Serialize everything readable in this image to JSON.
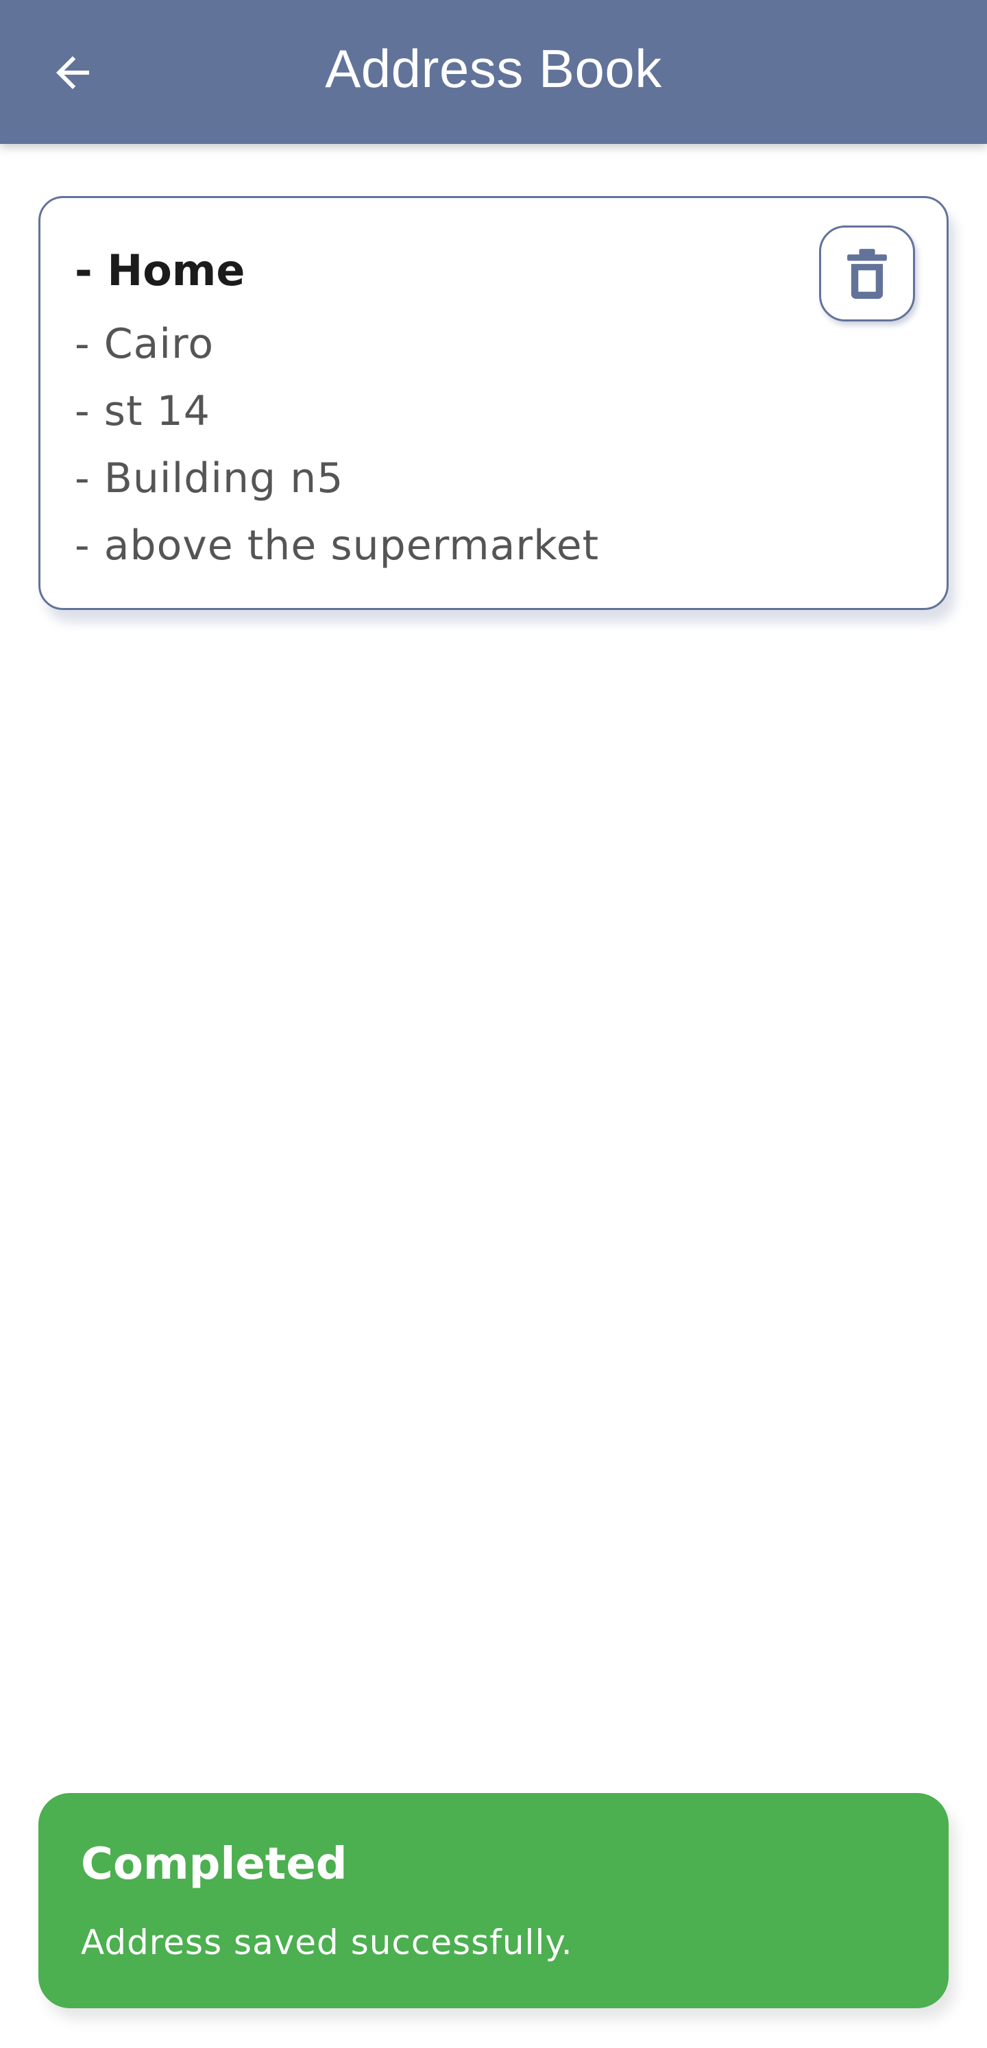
{
  "colors": {
    "appbar": "#62739a",
    "accent": "#62739a",
    "success": "#4caf50"
  },
  "appbar": {
    "title": "Address Book",
    "back_icon": "arrow-left-icon"
  },
  "addresses": [
    {
      "title": "- Home",
      "lines": [
        "- Cairo",
        "- st 14",
        "- Building n5",
        "- above the supermarket"
      ],
      "delete_icon": "trash-icon"
    }
  ],
  "toast": {
    "title": "Completed",
    "message": "Address saved successfully."
  }
}
